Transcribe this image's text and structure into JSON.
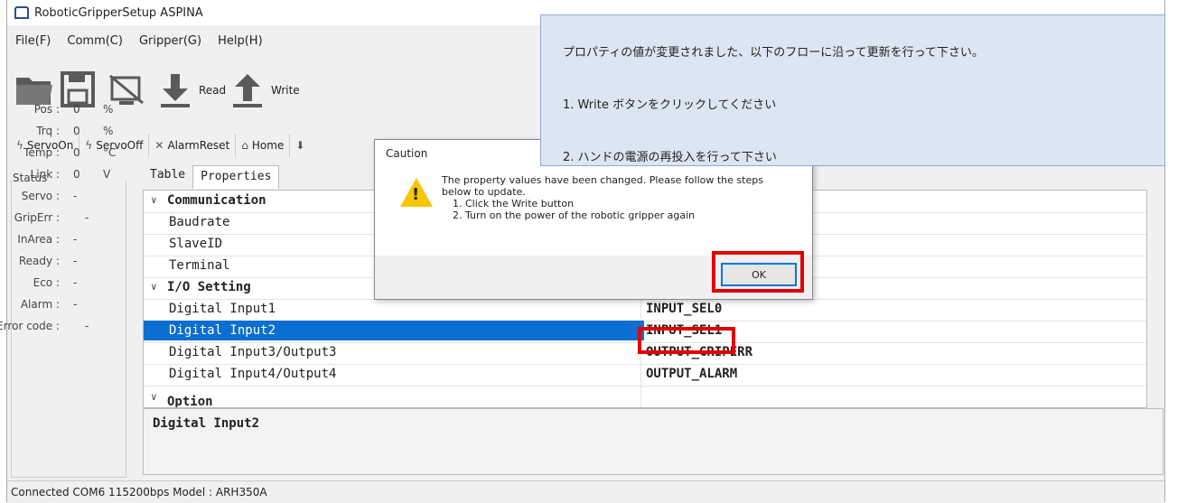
{
  "window": {
    "title": "RoboticGripperSetup ASPINA"
  },
  "menu": [
    "File(F)",
    "Comm(C)",
    "Gripper(G)",
    "Help(H)"
  ],
  "toolbar1": {
    "read_label": "Read",
    "write_label": "Write"
  },
  "toolbar2": {
    "servo_on": "ServoOn",
    "servo_off": "ServoOff",
    "alarm_reset": "AlarmReset",
    "home": "Home"
  },
  "status": {
    "title": "Status",
    "rows": [
      {
        "label": "Pos :",
        "value": "0",
        "unit": "%"
      },
      {
        "label": "Trq :",
        "value": "0",
        "unit": "%"
      },
      {
        "label": "Temp :",
        "value": "0",
        "unit": "°C"
      },
      {
        "label": "Link :",
        "value": "0",
        "unit": "V"
      },
      {
        "label": "Servo :",
        "value": "-",
        "unit": ""
      },
      {
        "label": "GripErr :",
        "value": "-",
        "unit": ""
      },
      {
        "label": "InArea :",
        "value": "-",
        "unit": ""
      },
      {
        "label": "Ready :",
        "value": "-",
        "unit": ""
      },
      {
        "label": "Eco :",
        "value": "-",
        "unit": ""
      },
      {
        "label": "Alarm :",
        "value": "-",
        "unit": ""
      },
      {
        "label": "Error code :",
        "value": "-",
        "unit": ""
      }
    ]
  },
  "tabs": [
    "Table",
    "Properties"
  ],
  "grid": {
    "cat_communication": "Communication",
    "baudrate": "Baudrate",
    "slaveid": "SlaveID",
    "terminal": "Terminal",
    "cat_io": "I/O Setting",
    "di1": "Digital Input1",
    "di1_val": "INPUT_SEL0",
    "di2": "Digital Input2",
    "di2_val": "INPUT_SEL1",
    "di3": "Digital Input3/Output3",
    "di3_val": "OUTPUT_GRIPERR",
    "di4": "Digital Input4/Output4",
    "di4_val": "OUTPUT_ALARM",
    "cat_option": "Option"
  },
  "description": "Digital Input2",
  "statusbar": "Connected COM6 115200bps  Model : ARH350A",
  "dialog": {
    "title": "Caution",
    "line1": "The property values have been changed. Please follow the steps",
    "line2": "below to update.",
    "line3": "1. Click the Write button",
    "line4": "2. Turn on the power of the robotic gripper again",
    "ok": "OK"
  },
  "note": {
    "line1": "プロパティの値が変更されました、以下のフローに沿って更新を行って下さい。",
    "line2": "1. Write ボタンをクリックしてください",
    "line3": "2. ハンドの電源の再投入を行って下さい"
  },
  "colors": {
    "highlight": "#e00000",
    "selection": "#0a6fd0",
    "note_bg": "#dce6f2"
  }
}
